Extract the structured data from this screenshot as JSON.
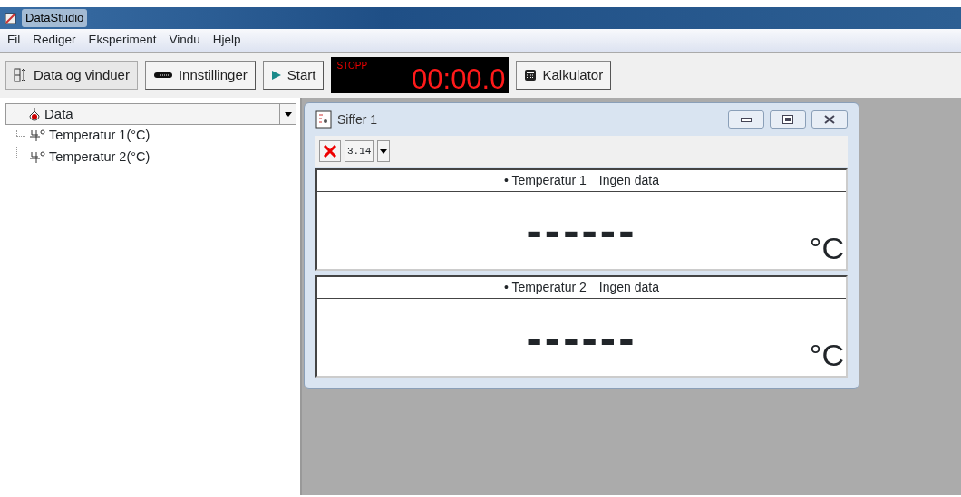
{
  "window": {
    "title": "DataStudio"
  },
  "menu": [
    "Fil",
    "Rediger",
    "Eksperiment",
    "Vindu",
    "Hjelp"
  ],
  "toolbar": {
    "buttons": [
      {
        "kind": "data",
        "label": "Data og vinduer",
        "selected": true
      },
      {
        "kind": "settings",
        "label": "Innstillinger",
        "selected": false
      },
      {
        "kind": "start",
        "label": "Start",
        "selected": false
      }
    ],
    "timer": {
      "state": "STOPP",
      "time": "00:00.0"
    },
    "calculator": {
      "label": "Kalkulator"
    }
  },
  "data_panel": {
    "header": "Data",
    "items": [
      {
        "label": "Temperatur 1(°C)"
      },
      {
        "label": "Temperatur 2(°C)"
      }
    ]
  },
  "digits_window": {
    "title": "Siffer 1",
    "format_button": "3.14",
    "displays": [
      {
        "bullet": "•",
        "name": "Temperatur 1",
        "status": "Ingen data",
        "reading": "------",
        "unit": "°C"
      },
      {
        "bullet": "•",
        "name": "Temperatur 2",
        "status": "Ingen data",
        "reading": "------",
        "unit": "°C"
      }
    ]
  }
}
